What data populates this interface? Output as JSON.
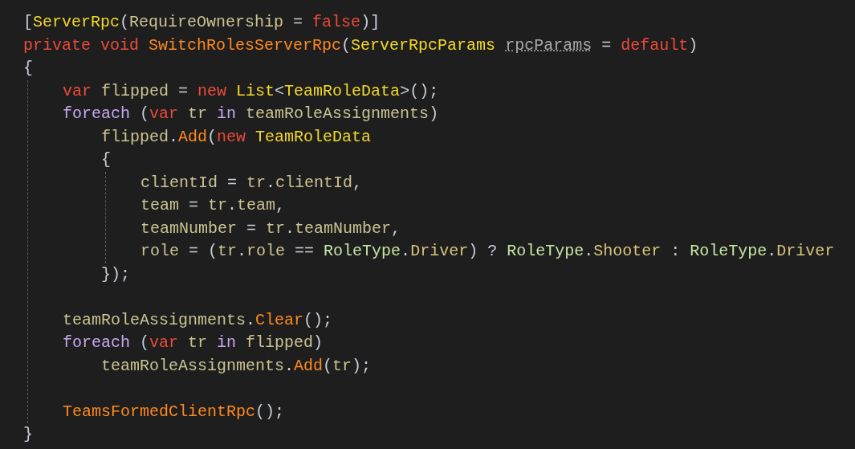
{
  "editor": {
    "lines": [
      {
        "kind": "code",
        "tokens": [
          {
            "text": "[",
            "kind": "punct"
          },
          {
            "text": "ServerRpc",
            "kind": "type"
          },
          {
            "text": "(",
            "kind": "punct"
          },
          {
            "text": "RequireOwnership",
            "kind": "ident"
          },
          {
            "text": " = ",
            "kind": "punct"
          },
          {
            "text": "false",
            "kind": "keyword"
          },
          {
            "text": ")]",
            "kind": "punct"
          }
        ]
      },
      {
        "kind": "code",
        "tokens": [
          {
            "text": "private void ",
            "kind": "keyword"
          },
          {
            "text": "SwitchRolesServerRpc",
            "kind": "method"
          },
          {
            "text": "(",
            "kind": "punct"
          },
          {
            "text": "ServerRpcParams ",
            "kind": "type"
          },
          {
            "text": "rpcParams",
            "kind": "unused"
          },
          {
            "text": " = ",
            "kind": "punct"
          },
          {
            "text": "default",
            "kind": "keyword"
          },
          {
            "text": ")",
            "kind": "punct"
          }
        ]
      },
      {
        "kind": "code",
        "guide": true,
        "tokens": [
          {
            "text": "{",
            "kind": "punct"
          }
        ],
        "children": [
          {
            "kind": "code",
            "tokens": [
              {
                "text": "var ",
                "kind": "keyword"
              },
              {
                "text": "flipped",
                "kind": "ident"
              },
              {
                "text": " = ",
                "kind": "punct"
              },
              {
                "text": "new ",
                "kind": "keyword"
              },
              {
                "text": "List",
                "kind": "type"
              },
              {
                "text": "<",
                "kind": "punct"
              },
              {
                "text": "TeamRoleData",
                "kind": "type"
              },
              {
                "text": ">();",
                "kind": "punct"
              }
            ]
          },
          {
            "kind": "code",
            "guide": false,
            "tokens": [
              {
                "text": "foreach ",
                "kind": "control"
              },
              {
                "text": "(",
                "kind": "punct"
              },
              {
                "text": "var ",
                "kind": "keyword"
              },
              {
                "text": "tr ",
                "kind": "ident"
              },
              {
                "text": "in ",
                "kind": "control"
              },
              {
                "text": "teamRoleAssignments",
                "kind": "ident"
              },
              {
                "text": ")",
                "kind": "punct"
              }
            ],
            "children": [
              {
                "kind": "code",
                "tokens": [
                  {
                    "text": "flipped",
                    "kind": "ident"
                  },
                  {
                    "text": ".",
                    "kind": "punct"
                  },
                  {
                    "text": "Add",
                    "kind": "method"
                  },
                  {
                    "text": "(",
                    "kind": "punct"
                  },
                  {
                    "text": "new ",
                    "kind": "keyword"
                  },
                  {
                    "text": "TeamRoleData",
                    "kind": "type"
                  }
                ]
              },
              {
                "kind": "code",
                "guide": true,
                "tokens": [
                  {
                    "text": "{",
                    "kind": "punct"
                  }
                ],
                "children": [
                  {
                    "kind": "code",
                    "tokens": [
                      {
                        "text": "clientId",
                        "kind": "ident"
                      },
                      {
                        "text": " = ",
                        "kind": "punct"
                      },
                      {
                        "text": "tr",
                        "kind": "ident"
                      },
                      {
                        "text": ".",
                        "kind": "punct"
                      },
                      {
                        "text": "clientId",
                        "kind": "ident"
                      },
                      {
                        "text": ",",
                        "kind": "punct"
                      }
                    ]
                  },
                  {
                    "kind": "code",
                    "tokens": [
                      {
                        "text": "team",
                        "kind": "ident"
                      },
                      {
                        "text": " = ",
                        "kind": "punct"
                      },
                      {
                        "text": "tr",
                        "kind": "ident"
                      },
                      {
                        "text": ".",
                        "kind": "punct"
                      },
                      {
                        "text": "team",
                        "kind": "ident"
                      },
                      {
                        "text": ",",
                        "kind": "punct"
                      }
                    ]
                  },
                  {
                    "kind": "code",
                    "tokens": [
                      {
                        "text": "teamNumber",
                        "kind": "ident"
                      },
                      {
                        "text": " = ",
                        "kind": "punct"
                      },
                      {
                        "text": "tr",
                        "kind": "ident"
                      },
                      {
                        "text": ".",
                        "kind": "punct"
                      },
                      {
                        "text": "teamNumber",
                        "kind": "ident"
                      },
                      {
                        "text": ",",
                        "kind": "punct"
                      }
                    ]
                  },
                  {
                    "kind": "code",
                    "tokens": [
                      {
                        "text": "role",
                        "kind": "ident"
                      },
                      {
                        "text": " = (",
                        "kind": "punct"
                      },
                      {
                        "text": "tr",
                        "kind": "ident"
                      },
                      {
                        "text": ".",
                        "kind": "punct"
                      },
                      {
                        "text": "role",
                        "kind": "ident"
                      },
                      {
                        "text": " == ",
                        "kind": "punct"
                      },
                      {
                        "text": "RoleType",
                        "kind": "enum"
                      },
                      {
                        "text": ".",
                        "kind": "punct"
                      },
                      {
                        "text": "Driver",
                        "kind": "member"
                      },
                      {
                        "text": ") ? ",
                        "kind": "punct"
                      },
                      {
                        "text": "RoleType",
                        "kind": "enum"
                      },
                      {
                        "text": ".",
                        "kind": "punct"
                      },
                      {
                        "text": "Shooter",
                        "kind": "member"
                      },
                      {
                        "text": " : ",
                        "kind": "punct"
                      },
                      {
                        "text": "RoleType",
                        "kind": "enum"
                      },
                      {
                        "text": ".",
                        "kind": "punct"
                      },
                      {
                        "text": "Driver",
                        "kind": "member"
                      }
                    ]
                  }
                ]
              },
              {
                "kind": "code",
                "tokens": [
                  {
                    "text": "});",
                    "kind": "punct"
                  }
                ]
              }
            ]
          },
          {
            "kind": "blank"
          },
          {
            "kind": "code",
            "tokens": [
              {
                "text": "teamRoleAssignments",
                "kind": "ident"
              },
              {
                "text": ".",
                "kind": "punct"
              },
              {
                "text": "Clear",
                "kind": "method"
              },
              {
                "text": "();",
                "kind": "punct"
              }
            ]
          },
          {
            "kind": "code",
            "guide": false,
            "tokens": [
              {
                "text": "foreach ",
                "kind": "control"
              },
              {
                "text": "(",
                "kind": "punct"
              },
              {
                "text": "var ",
                "kind": "keyword"
              },
              {
                "text": "tr ",
                "kind": "ident"
              },
              {
                "text": "in ",
                "kind": "control"
              },
              {
                "text": "flipped",
                "kind": "ident"
              },
              {
                "text": ")",
                "kind": "punct"
              }
            ],
            "children": [
              {
                "kind": "code",
                "tokens": [
                  {
                    "text": "teamRoleAssignments",
                    "kind": "ident"
                  },
                  {
                    "text": ".",
                    "kind": "punct"
                  },
                  {
                    "text": "Add",
                    "kind": "method"
                  },
                  {
                    "text": "(",
                    "kind": "punct"
                  },
                  {
                    "text": "tr",
                    "kind": "ident"
                  },
                  {
                    "text": ");",
                    "kind": "punct"
                  }
                ]
              }
            ]
          },
          {
            "kind": "blank"
          },
          {
            "kind": "code",
            "tokens": [
              {
                "text": "TeamsFormedClientRpc",
                "kind": "method"
              },
              {
                "text": "();",
                "kind": "punct"
              }
            ]
          }
        ]
      },
      {
        "kind": "code",
        "tokens": [
          {
            "text": "}",
            "kind": "punct"
          }
        ]
      }
    ]
  }
}
